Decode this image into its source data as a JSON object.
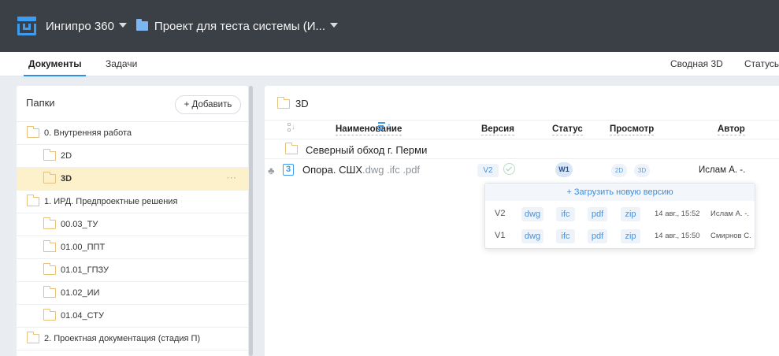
{
  "header": {
    "app_name": "Ингипро 360",
    "project_name": "Проект для теста системы (И...",
    "colors": {
      "bar": "#3b4046",
      "accent": "#3d9cf0"
    }
  },
  "tabs": {
    "left": [
      {
        "label": "Документы",
        "active": true
      },
      {
        "label": "Задачи",
        "active": false
      }
    ],
    "right": [
      {
        "label": "Сводная 3D"
      },
      {
        "label": "Статусы"
      }
    ]
  },
  "folders_panel": {
    "title": "Папки",
    "add_label": "+ Добавить",
    "items": [
      {
        "label": "0. Внутренняя работа",
        "level": 0
      },
      {
        "label": "2D",
        "level": 1
      },
      {
        "label": "3D",
        "level": 1,
        "selected": true,
        "more": "···"
      },
      {
        "label": "1. ИРД. Предпроектные решения",
        "level": 0
      },
      {
        "label": "00.03_ТУ",
        "level": 1
      },
      {
        "label": "01.00_ППТ",
        "level": 1
      },
      {
        "label": "01.01_ГПЗУ",
        "level": 1
      },
      {
        "label": "01.02_ИИ",
        "level": 1
      },
      {
        "label": "01.04_СТУ",
        "level": 1
      },
      {
        "label": "2. Проектная документация (стадия П)",
        "level": 0
      }
    ]
  },
  "documents": {
    "folder_title": "3D",
    "columns": {
      "name": "Наименование",
      "version": "Версия",
      "status": "Статус",
      "preview": "Просмотр",
      "author": "Автор"
    },
    "subfolder": "Северный обход г. Перми",
    "file": {
      "number": "3",
      "name": "Опора. СШХ",
      "ext_main": ".dwg",
      "ext_extra": ".ifc .pdf",
      "version": "V2",
      "status": "W1",
      "preview_2d": "2D",
      "preview_3d": "3D",
      "author": "Ислам А. -."
    }
  },
  "versions_popup": {
    "upload_label": "+ Загрузить новую версию",
    "rows": [
      {
        "version": "V2",
        "formats": [
          "dwg",
          "ifc",
          "pdf",
          "zip"
        ],
        "date": "14 авг., 15:52",
        "author": "Ислам А. -."
      },
      {
        "version": "V1",
        "formats": [
          "dwg",
          "ifc",
          "pdf",
          "zip"
        ],
        "date": "14 авг., 15:50",
        "author": "Смирнов С."
      }
    ]
  }
}
